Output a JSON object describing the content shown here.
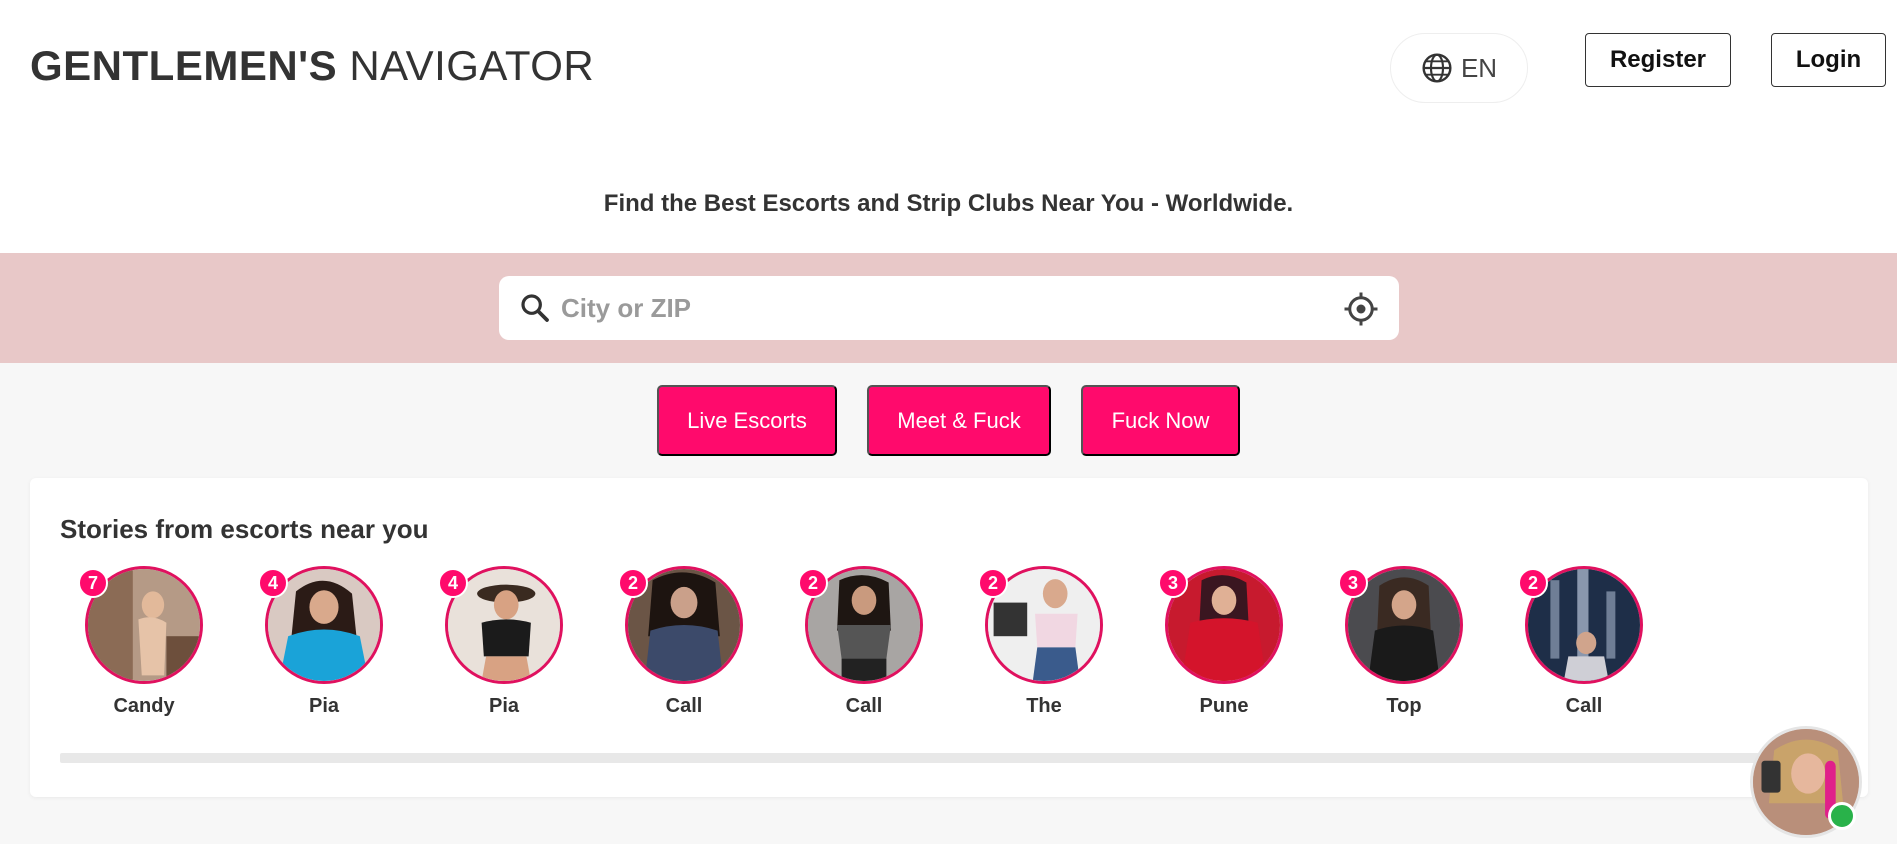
{
  "header": {
    "logo_bold": "GENTLEMEN'S",
    "logo_light": "NAVIGATOR",
    "language": "EN",
    "register_label": "Register",
    "login_label": "Login"
  },
  "hero": {
    "tagline": "Find the Best Escorts and Strip Clubs Near You - Worldwide."
  },
  "search": {
    "placeholder": "City or ZIP",
    "value": ""
  },
  "actions": [
    {
      "label": "Live Escorts"
    },
    {
      "label": "Meet & Fuck"
    },
    {
      "label": "Fuck Now"
    }
  ],
  "stories": {
    "title": "Stories from escorts near you",
    "items": [
      {
        "name": "Candy",
        "count": "7"
      },
      {
        "name": "Pia",
        "count": "4"
      },
      {
        "name": "Pia",
        "count": "4"
      },
      {
        "name": "Call",
        "count": "2"
      },
      {
        "name": "Call",
        "count": "2"
      },
      {
        "name": "The",
        "count": "2"
      },
      {
        "name": "Pune",
        "count": "3"
      },
      {
        "name": "Top",
        "count": "3"
      },
      {
        "name": "Call",
        "count": "2"
      }
    ]
  },
  "colors": {
    "accent": "#ff0a6c",
    "ring": "#e0115f",
    "search_band": "#e8c8c8",
    "online": "#29b24a"
  },
  "icons": [
    "globe-icon",
    "search-icon",
    "locate-icon"
  ]
}
